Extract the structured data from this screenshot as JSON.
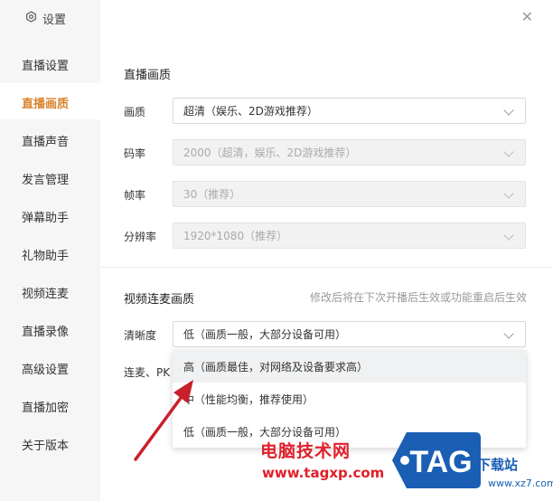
{
  "sidebar": {
    "title": "设置",
    "items": [
      {
        "label": "直播设置",
        "active": false
      },
      {
        "label": "直播画质",
        "active": true
      },
      {
        "label": "直播声音",
        "active": false
      },
      {
        "label": "发言管理",
        "active": false
      },
      {
        "label": "弹幕助手",
        "active": false
      },
      {
        "label": "礼物助手",
        "active": false
      },
      {
        "label": "视频连麦",
        "active": false
      },
      {
        "label": "直播录像",
        "active": false
      },
      {
        "label": "高级设置",
        "active": false
      },
      {
        "label": "直播加密",
        "active": false
      },
      {
        "label": "关于版本",
        "active": false
      }
    ]
  },
  "quality": {
    "title": "直播画质",
    "picture": {
      "label": "画质",
      "value": "超清（娱乐、2D游戏推荐）"
    },
    "bitrate": {
      "label": "码率",
      "value": "2000（超清，娱乐、2D游戏推荐）"
    },
    "fps": {
      "label": "帧率",
      "value": "30（推荐）"
    },
    "resolution": {
      "label": "分辨率",
      "value": "1920*1080（推荐）"
    }
  },
  "linkmic": {
    "title": "视频连麦画质",
    "hint": "修改后将在下次开播后生效或功能重启后生效",
    "clarity": {
      "label": "清晰度",
      "value": "低（画质一般，大部分设备可用）"
    },
    "partial_label": "连麦、PK",
    "options": [
      "高（画质最佳，对网络及设备要求高）",
      "中（性能均衡，推荐使用）",
      "低（画质一般，大部分设备可用）"
    ]
  },
  "watermark": {
    "cn": "电脑技术网",
    "url": "www.tagxp.com",
    "tag": "TAG",
    "dl": "下载站",
    "dl_url": "www.xz7.com"
  },
  "colors": {
    "accent": "#d9822b",
    "watermark_red": "#e0202a",
    "watermark_blue": "#1a5fb4"
  }
}
